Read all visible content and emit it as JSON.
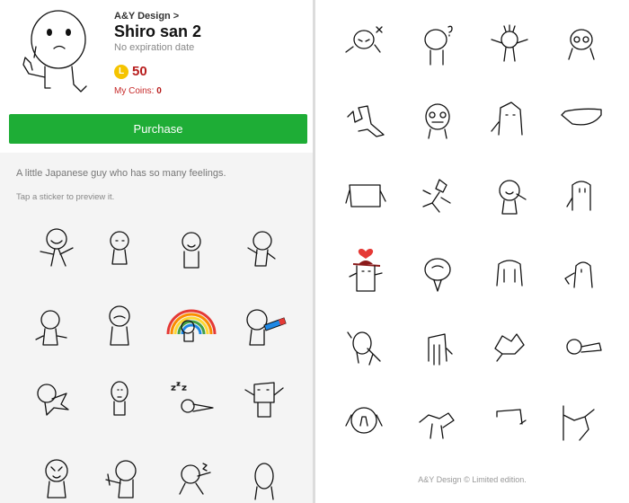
{
  "product": {
    "creator": "A&Y Design >",
    "title": "Shiro san 2",
    "expiry": "No expiration date",
    "coin_icon": "L",
    "price": "50",
    "my_coins_label": "My Coins:",
    "my_coins_value": "0"
  },
  "purchase_label": "Purchase",
  "description": "A little Japanese guy who has so many feelings.",
  "preview_hint": "Tap a sticker to preview it.",
  "footer": "A&Y Design © Limited edition.",
  "colors": {
    "purchase_bg": "#1ead36",
    "price": "#b71c1c",
    "coin": "#f5c400"
  },
  "icons": {
    "coin": "line-coin-icon",
    "sticker": "stick-figure-sticker"
  }
}
